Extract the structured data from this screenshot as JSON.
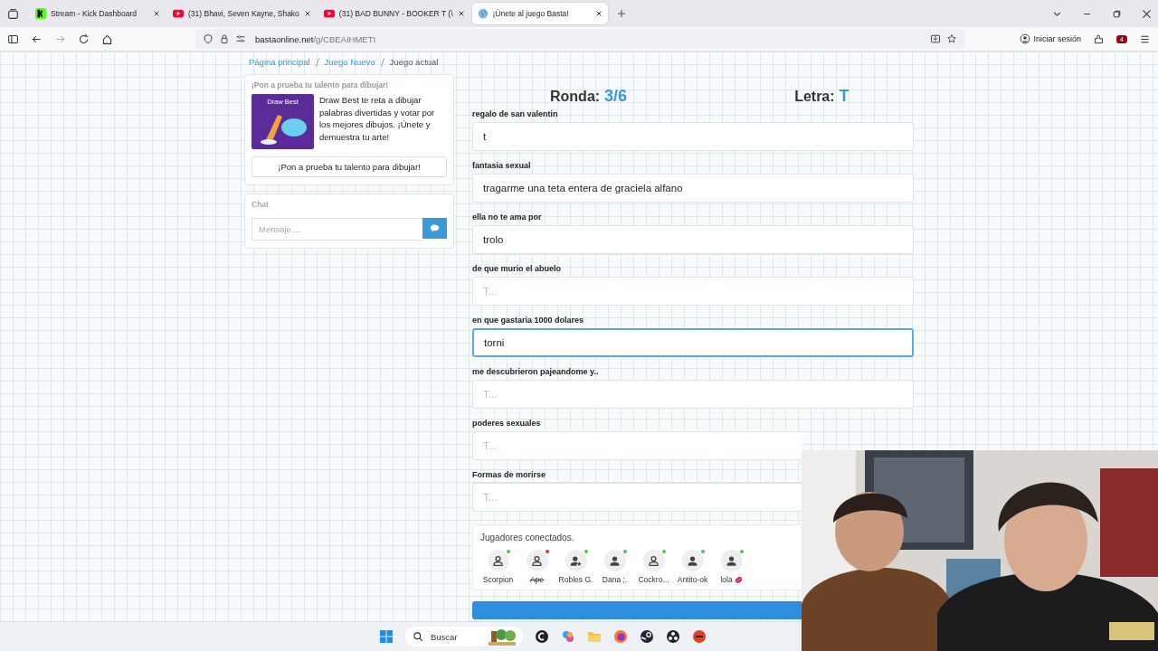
{
  "browser": {
    "tabs": [
      {
        "title": "Stream - Kick Dashboard",
        "kind": "kick",
        "selected": false
      },
      {
        "title": "(31) Bhavi, Seven Kayne, Shako",
        "kind": "youtube",
        "selected": false
      },
      {
        "title": "(31) BAD BUNNY - BOOKER T (\\",
        "kind": "youtube",
        "selected": false
      },
      {
        "title": "¡Únete al juego Basta!",
        "kind": "globe",
        "selected": true
      }
    ],
    "url_host": "bastaonline.net",
    "url_path": "/g/CBEAIHMETI",
    "sign_in": "Iniciar sesión",
    "extension_badge": "4"
  },
  "breadcrumb": [
    {
      "label": "Página principal",
      "link": true
    },
    {
      "label": "Juego Nuevo",
      "link": true
    },
    {
      "label": "Juego actual",
      "link": false
    }
  ],
  "promo": {
    "heading": "¡Pon a prueba tu talento para dibujar!",
    "image_title": "Draw Best",
    "text": "Draw Best te reta a dibujar palabras divertidas y votar por los mejores dibujos. ¡Únete y demuestra tu arte!",
    "button": "¡Pon a prueba tu talento para dibujar!"
  },
  "chat": {
    "title": "Chat",
    "placeholder": "Mensaje...."
  },
  "game": {
    "round_label": "Ronda:",
    "round": "3/6",
    "letter_label": "Letra:",
    "letter": "T"
  },
  "fields": [
    {
      "label": "regalo de san valentin",
      "value": "t",
      "focused": false
    },
    {
      "label": "fantasia sexual",
      "value": "tragarme una teta entera de graciela alfano",
      "focused": false
    },
    {
      "label": "ella no te ama por",
      "value": "trolo",
      "focused": false
    },
    {
      "label": "de que murio el abuelo",
      "placeholder": "T...",
      "focused": false
    },
    {
      "label": "en que gastaria 1000 dolares",
      "value": "torni",
      "focused": true
    },
    {
      "label": "me descubrieron pajeandome y..",
      "placeholder": "T...",
      "focused": false
    },
    {
      "label": "poderes sexuales",
      "placeholder": "T...",
      "focused": false
    },
    {
      "label": "Formas de morirse",
      "placeholder": "T...",
      "focused": false
    }
  ],
  "players": {
    "title": "Jugadores conectados.",
    "list": [
      {
        "name": "Scorpion",
        "kind": "outline",
        "online": true,
        "badge": false
      },
      {
        "name": "Ape",
        "kind": "outline",
        "online": false,
        "badge": false
      },
      {
        "name": "Robles G.",
        "kind": "star",
        "online": true,
        "badge": false
      },
      {
        "name": "Dana ;.",
        "kind": "filled",
        "online": true,
        "badge": false
      },
      {
        "name": "Cockro...",
        "kind": "outline",
        "online": true,
        "badge": false
      },
      {
        "name": "Antito-ok",
        "kind": "filled",
        "online": true,
        "badge": false
      },
      {
        "name": "lola",
        "kind": "filled",
        "online": true,
        "badge": true
      }
    ]
  },
  "taskbar": {
    "search": "Buscar"
  }
}
